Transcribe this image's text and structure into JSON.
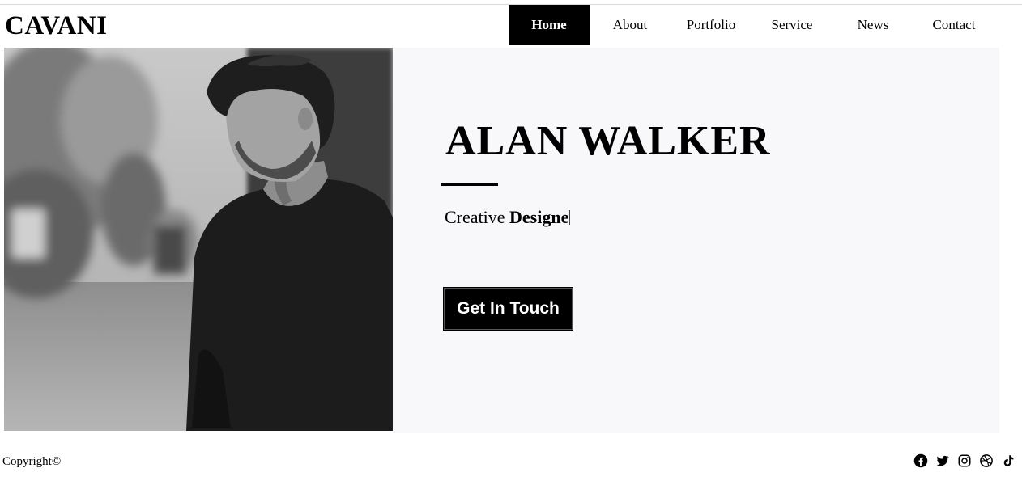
{
  "brand": {
    "name": "CAVANI"
  },
  "nav": {
    "active_index": 0,
    "items": [
      {
        "label": "Home"
      },
      {
        "label": "About"
      },
      {
        "label": "Portfolio"
      },
      {
        "label": "Service"
      },
      {
        "label": "News"
      },
      {
        "label": "Contact"
      }
    ]
  },
  "hero": {
    "name": "ALAN WALKER",
    "tagline_prefix": "Creative",
    "tagline_role": "Designe",
    "cta_label": "Get In Touch",
    "panel_color": "#f8f7f9"
  },
  "footer": {
    "copyright": "Copyright©",
    "social": [
      {
        "icon": "facebook-icon"
      },
      {
        "icon": "twitter-icon"
      },
      {
        "icon": "instagram-icon"
      },
      {
        "icon": "dribbble-icon"
      },
      {
        "icon": "tiktok-icon"
      }
    ]
  },
  "colors": {
    "accent": "#000000",
    "background": "#ffffff"
  }
}
